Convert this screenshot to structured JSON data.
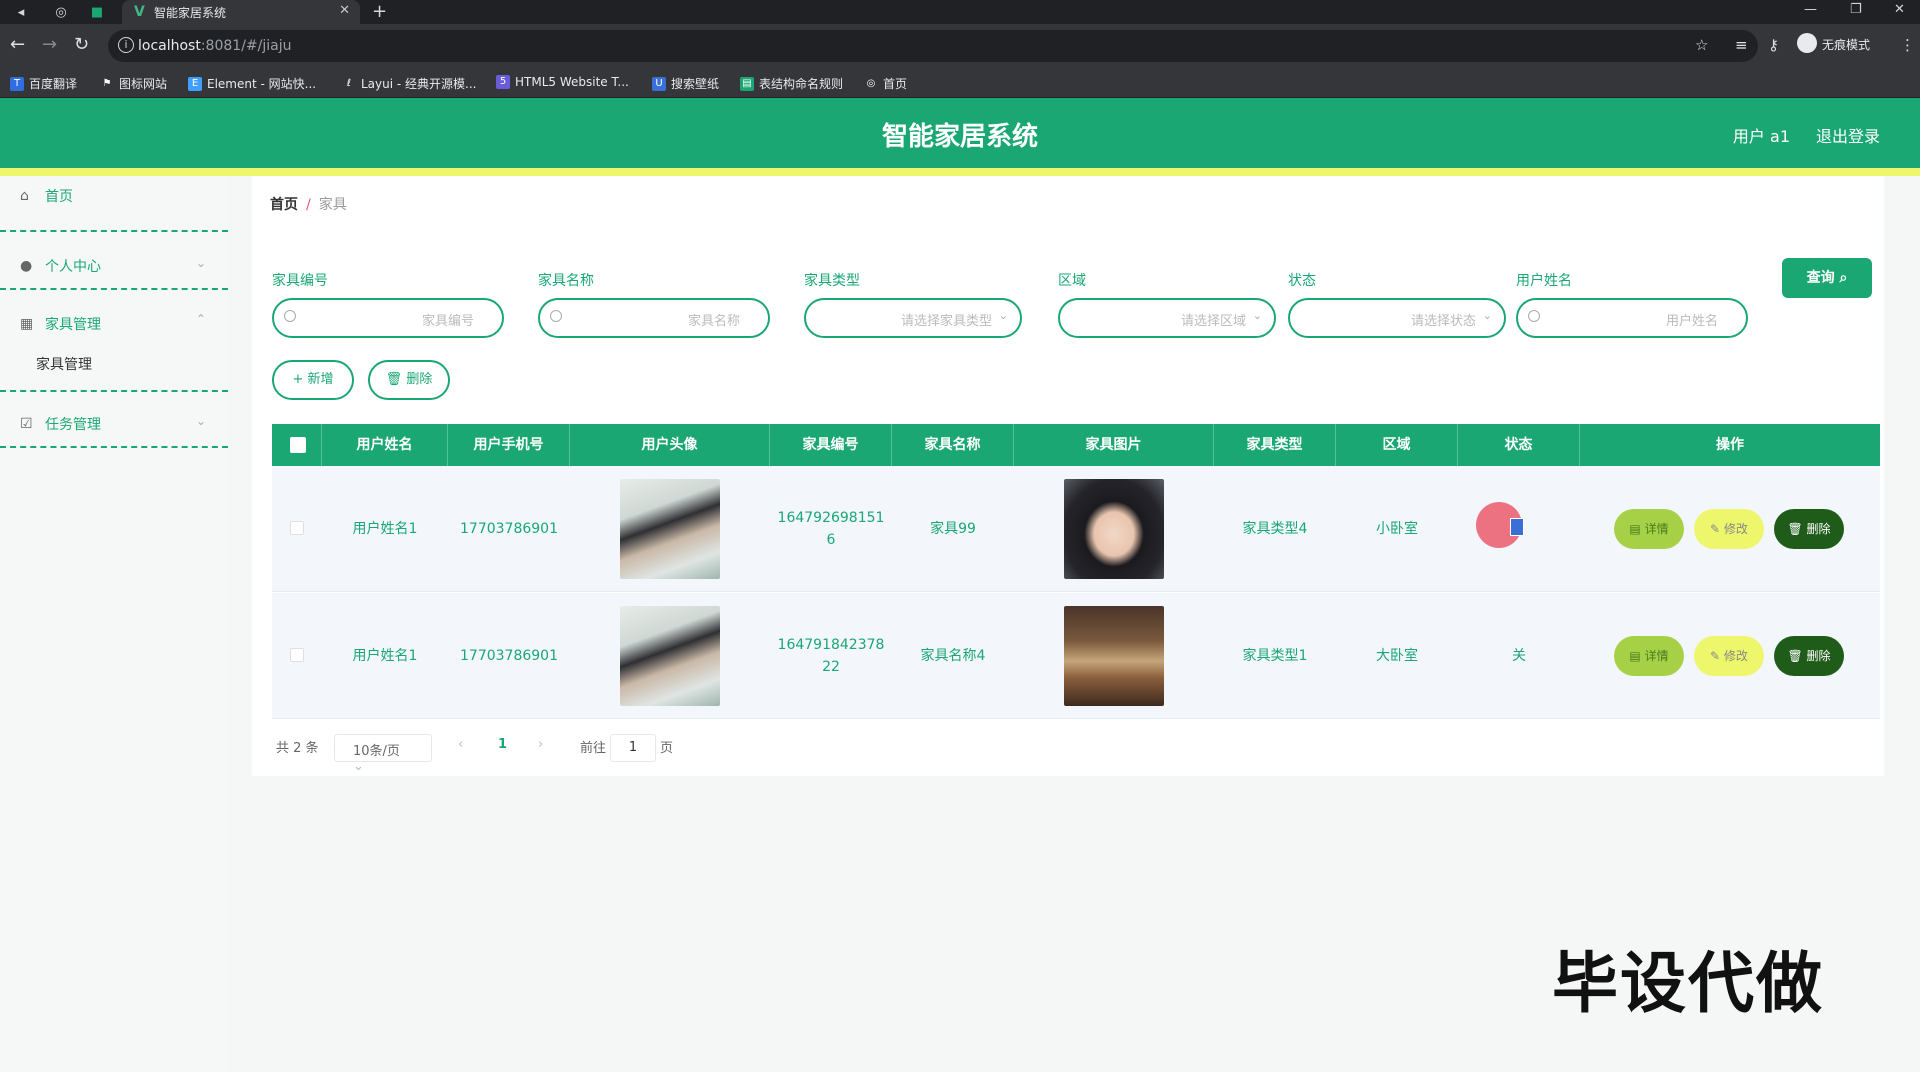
{
  "browser": {
    "tab_title": "智能家居系统",
    "url_host": "localhost",
    "url_rest": ":8081/#/jiaju",
    "incognito_label": "无痕模式",
    "bookmarks": [
      "百度翻译",
      "图标网站",
      "Element - 网站快...",
      "Layui - 经典开源模...",
      "HTML5 Website T...",
      "搜索壁纸",
      "表结构命名规则",
      "首页"
    ]
  },
  "header": {
    "title": "智能家居系统",
    "user": "用户 a1",
    "logout": "退出登录"
  },
  "sidebar": {
    "items": [
      {
        "label": "首页",
        "icon": "home-icon"
      },
      {
        "label": "个人中心",
        "icon": "user-icon"
      },
      {
        "label": "家具管理",
        "icon": "grid-icon"
      },
      {
        "label": "任务管理",
        "icon": "checklist-icon"
      }
    ],
    "sub_item": "家具管理"
  },
  "breadcrumb": {
    "home": "首页",
    "sep": "/",
    "current": "家具"
  },
  "filters": [
    {
      "label": "家具编号",
      "placeholder": "家具编号",
      "type": "input"
    },
    {
      "label": "家具名称",
      "placeholder": "家具名称",
      "type": "input"
    },
    {
      "label": "家具类型",
      "placeholder": "请选择家具类型",
      "type": "select"
    },
    {
      "label": "区域",
      "placeholder": "请选择区域",
      "type": "select"
    },
    {
      "label": "状态",
      "placeholder": "请选择状态",
      "type": "select"
    },
    {
      "label": "用户姓名",
      "placeholder": "用户姓名",
      "type": "input"
    }
  ],
  "buttons": {
    "search": "查询",
    "add": "+ 新增",
    "delete": "删除"
  },
  "table": {
    "columns": [
      "用户姓名",
      "用户手机号",
      "用户头像",
      "家具编号",
      "家具名称",
      "家具图片",
      "家具类型",
      "区域",
      "状态",
      "操作"
    ],
    "rows": [
      {
        "user_name": "用户姓名1",
        "phone": "17703786901",
        "code_line1": "164792698151",
        "code_line2": "6",
        "name": "家具99",
        "type": "家具类型4",
        "area": "小卧室",
        "status": "",
        "image": "portrait"
      },
      {
        "user_name": "用户姓名1",
        "phone": "17703786901",
        "code_line1": "164791842378",
        "code_line2": "22",
        "name": "家具名称4",
        "type": "家具类型1",
        "area": "大卧室",
        "status": "关",
        "image": "room"
      }
    ],
    "actions": {
      "detail": "详情",
      "edit": "修改",
      "delete": "删除"
    }
  },
  "pagination": {
    "total": "共 2 条",
    "page_size": "10条/页",
    "current_page": "1",
    "goto_label": "前往",
    "goto_value": "1",
    "page_suffix": "页"
  },
  "watermark": "毕设代做",
  "colors": {
    "primary": "#1aa774",
    "accent_yellow": "#eef76b",
    "detail_btn": "#a6d147",
    "delete_btn": "#1f5c1a"
  }
}
